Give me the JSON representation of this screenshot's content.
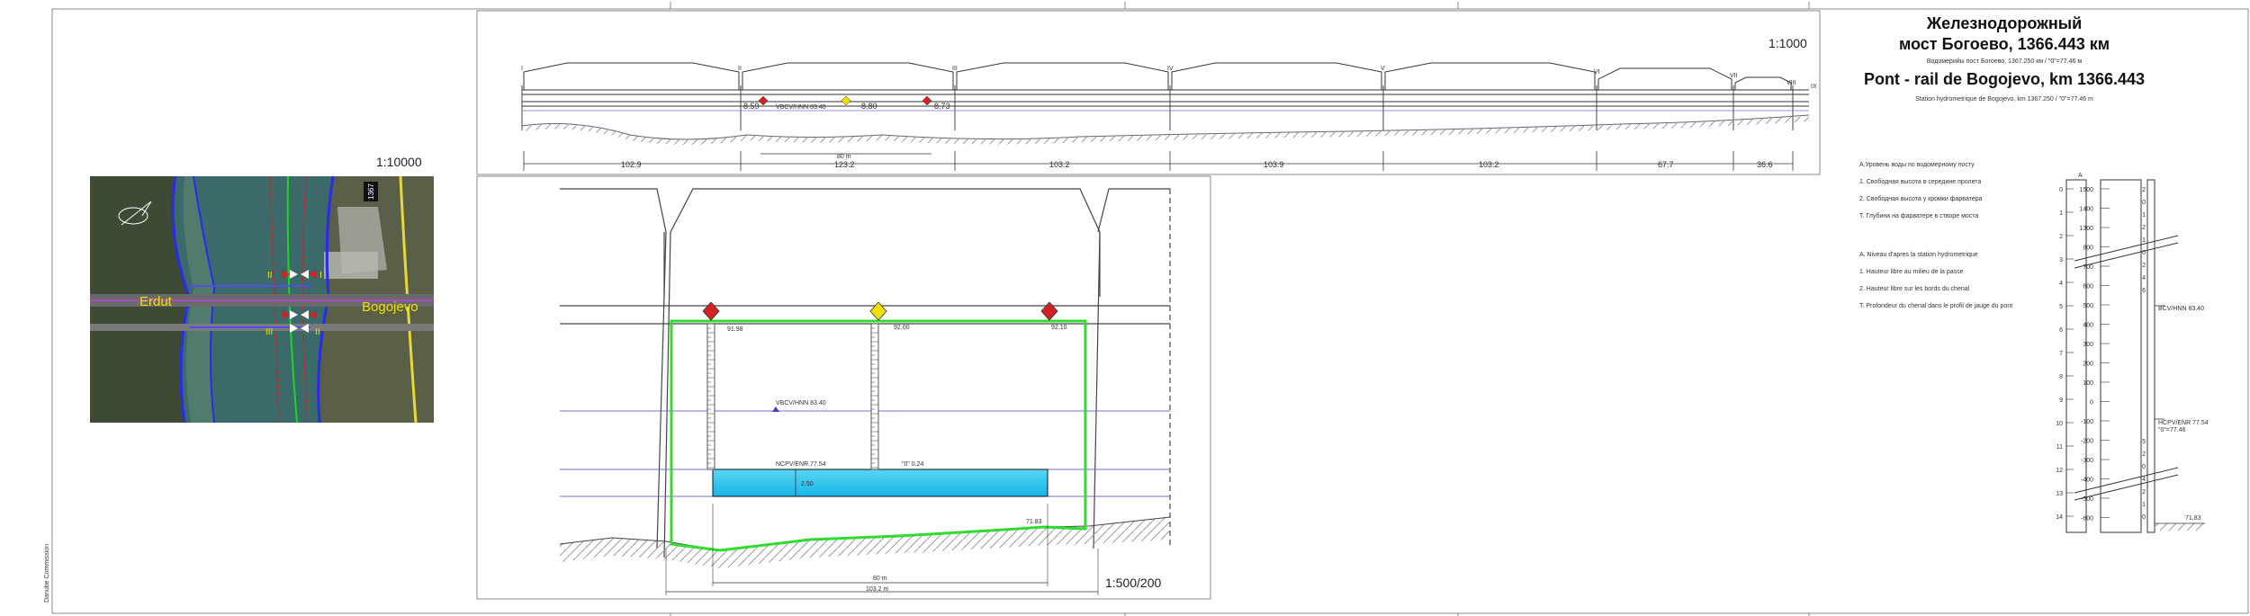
{
  "title": {
    "ru_line1": "Железнодорожный",
    "ru_line2": "мост Богоево, 1366.443 км",
    "ru_sub": "Водомерийы пост Богоево, 1367.250 км / \"0\"=77.46 м",
    "fr_title": "Pont - rail de Bogojevo, km 1366.443",
    "fr_sub": "Station hydrometrique de Bogojevo, km 1367.250 / \"0\"=77.46 m"
  },
  "legend_ru": [
    "А.Уровень воды по водомерному посту",
    "1. Свободная высота в середине пролета",
    "2. Свободная высота у кромки фарватера",
    "Т. Глубина на фарватере в створе моста"
  ],
  "legend_fr": [
    "A. Niveau d'apres la station hydrometrique",
    "1. Hauteur libre au milieu de la passe",
    "2. Hauteur libre sur les bords du chenal",
    "T. Profondeur du chenal dans le profil de jauge du pont"
  ],
  "scales": {
    "plan": "1:10000",
    "elevation": "1:1000",
    "section": "1:500/200"
  },
  "map": {
    "place_left": "Erdut",
    "place_right": "Bogojevo",
    "km_badge": "1367",
    "marks": [
      "II",
      "I",
      "III",
      "II"
    ]
  },
  "elevation": {
    "span_lengths": [
      "102.9",
      "123.2",
      "103.2",
      "103.9",
      "103.2",
      "67.7",
      "36.6"
    ],
    "pier_labels": [
      "I",
      "II",
      "III",
      "IV",
      "V",
      "VI",
      "VII",
      "VIII",
      "IX"
    ],
    "nav_width": "80 m",
    "clearances": [
      "8.59",
      "8.80",
      "8.73"
    ],
    "level_label": "VBCV/HNN 83.40"
  },
  "section": {
    "nav_width": "80 m",
    "total_width": "103.2 m",
    "top_levels": [
      "91.98",
      "92.00",
      "92.10"
    ],
    "high_level": "VBCV/HNN 83.40",
    "low_level": "NCPV/ENR 77.54",
    "zero_level": "\"0\" 0.24",
    "depth": "2.50",
    "bed_level": "71.83"
  },
  "gauge": {
    "header": "A",
    "left_ticks": [
      "0",
      "1",
      "2",
      "3",
      "4",
      "5",
      "6",
      "7",
      "8",
      "9",
      "10",
      "11",
      "12",
      "13",
      "14"
    ],
    "center_values": [
      "1500",
      "1400",
      "1300",
      "800",
      "700",
      "600",
      "500",
      "400",
      "300",
      "200",
      "100",
      "0",
      "-100",
      "-200",
      "-300",
      "-400",
      "-500",
      "-600"
    ],
    "right_upper": [
      "2",
      "0",
      "1",
      "2",
      "1",
      "0",
      "2",
      "4",
      "6"
    ],
    "right_lower": [
      "5",
      "2",
      "0",
      "4",
      "2",
      "1",
      "0"
    ],
    "high_level": "BCV/HNN 83.40",
    "low_level": "HCPV/ENR 77.54",
    "zero_label": "\"0\"=77.46",
    "bed_level": "71.83"
  },
  "colors": {
    "water": "#1ec6ef",
    "navigation": "#2fdc2f",
    "level_line": "#7070d0",
    "red_mark": "#d42020",
    "yellow_mark": "#f0e000",
    "river": "#3c6a6a"
  },
  "stamp": "Danube Commission"
}
